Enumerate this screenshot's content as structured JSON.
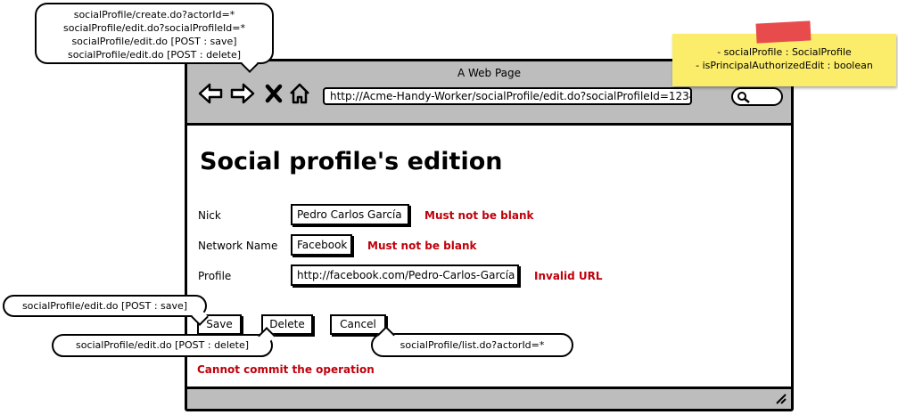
{
  "window": {
    "title": "A Web Page",
    "url": "http://Acme-Handy-Worker/socialProfile/edit.do?socialProfileId=12345"
  },
  "page": {
    "heading": "Social profile's edition",
    "fields": [
      {
        "label": "Nick",
        "value": "Pedro Carlos García",
        "error": "Must not be blank"
      },
      {
        "label": "Network Name",
        "value": "Facebook",
        "error": "Must not be blank"
      },
      {
        "label": "Profile",
        "value": "http://facebook.com/Pedro-Carlos-García",
        "error": "Invalid URL"
      }
    ],
    "buttons": {
      "save": "Save",
      "delete": "Delete",
      "cancel": "Cancel"
    },
    "global_error": "Cannot commit the operation"
  },
  "annotations": {
    "top_callout": [
      "socialProfile/create.do?actorId=*",
      "socialProfile/edit.do?socialProfileId=*",
      "socialProfile/edit.do [POST : save]",
      "socialProfile/edit.do [POST : delete]"
    ],
    "save_callout": "socialProfile/edit.do [POST : save]",
    "delete_callout": "socialProfile/edit.do [POST : delete]",
    "cancel_callout": "socialProfile/list.do?actorId=*",
    "model_note": [
      "- socialProfile : SocialProfile",
      "- isPrincipalAuthorizedEdit : boolean"
    ]
  },
  "icons": [
    "back-arrow-icon",
    "forward-arrow-icon",
    "stop-icon",
    "home-icon",
    "search-icon",
    "resize-grip-icon"
  ],
  "colors": {
    "error": "#c0000b",
    "chrome": "#bdbdbd",
    "note": "#fbed6a",
    "tape": "#e84b4b"
  }
}
